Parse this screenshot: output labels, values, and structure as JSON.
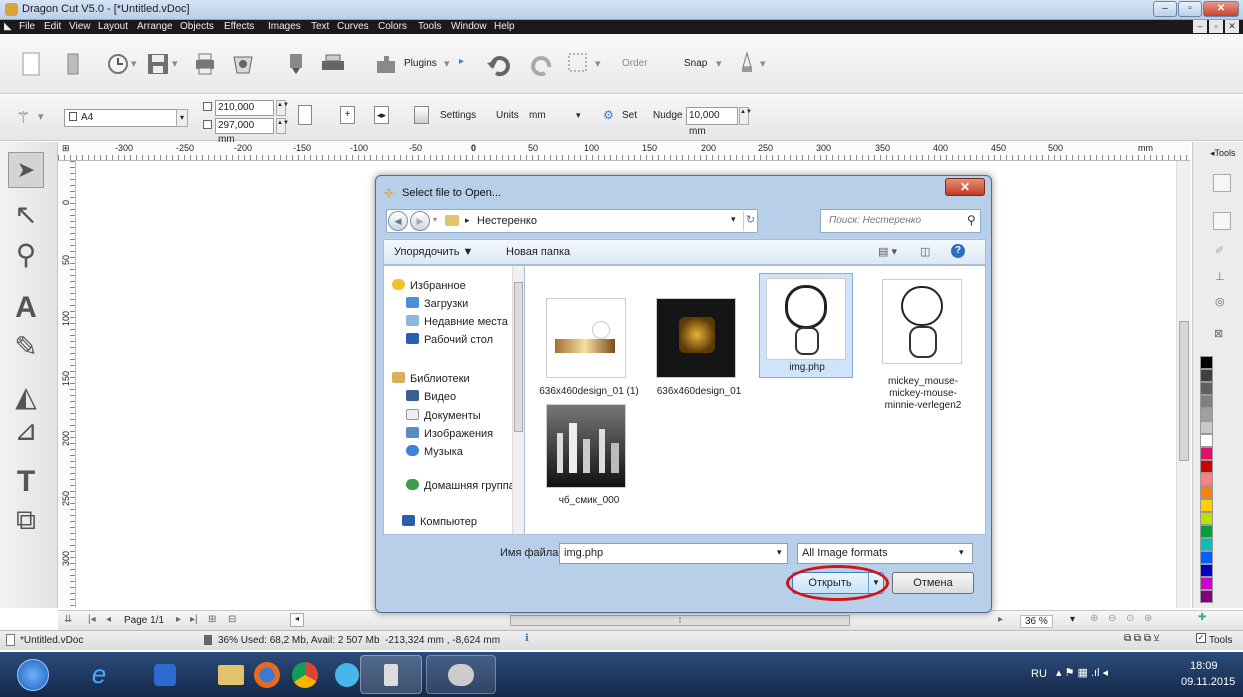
{
  "window": {
    "title": "Dragon Cut V5.0 - [*Untitled.vDoc]"
  },
  "menu": [
    "File",
    "Edit",
    "View",
    "Layout",
    "Arrange",
    "Objects",
    "Effects",
    "Images",
    "Text",
    "Curves",
    "Colors",
    "Tools",
    "Window",
    "Help"
  ],
  "toolbar": {
    "plugins": "Plugins",
    "order": "Order",
    "snap": "Snap"
  },
  "props": {
    "page_size": "A4",
    "width": "210,000 mm",
    "height": "297,000 mm",
    "settings": "Settings",
    "units_label": "Units",
    "units_value": "mm",
    "set": "Set",
    "nudge_label": "Nudge",
    "nudge_value": "10,000 mm"
  },
  "ruler": {
    "top": [
      "-300",
      "-250",
      "-200",
      "-150",
      "-100",
      "-50",
      "0",
      "50",
      "100",
      "150",
      "200",
      "250",
      "300",
      "350",
      "400",
      "450",
      "500"
    ],
    "unit": "mm",
    "left": [
      "0",
      "50",
      "100",
      "150",
      "200",
      "250",
      "300"
    ]
  },
  "right_panel": {
    "title": "Tools"
  },
  "palette": [
    "#000000",
    "#404040",
    "#606060",
    "#808080",
    "#a0a0a0",
    "#c8c8c8",
    "#ffffff",
    "#e0106a",
    "#d00000",
    "#ff8080",
    "#ff8000",
    "#ffd000",
    "#c0e000",
    "#00a040",
    "#00c0c0",
    "#0060ff",
    "#0000c0",
    "#d000d0",
    "#800080"
  ],
  "bottom": {
    "page": "Page 1/1",
    "zoom": "36 %"
  },
  "status": {
    "doc": "*Untitled.vDoc",
    "memory": "36%  Used: 68,2 Mb, Avail: 2 507 Mb",
    "coords": "-213,324 mm , -8,624 mm",
    "tools": "Tools"
  },
  "taskbar": {
    "lang": "RU",
    "time": "18:09",
    "date": "09.11.2015"
  },
  "dialog": {
    "title": "Select file to Open...",
    "path": "Нестеренко",
    "search_placeholder": "Поиск: Нестеренко",
    "organize": "Упорядочить ▼",
    "new_folder": "Новая папка",
    "nav": [
      "Избранное",
      "Загрузки",
      "Недавние места",
      "Рабочий стол",
      "Библиотеки",
      "Видео",
      "Документы",
      "Изображения",
      "Музыка",
      "Домашняя группа",
      "Компьютер"
    ],
    "files": [
      "636x460design_01 (1)",
      "636x460design_01",
      "img.php",
      "mickey_mouse-mickey-mouse-minnie-verlegen2",
      "чб_смик_000"
    ],
    "filename_label": "Имя файла:",
    "filename_value": "img.php",
    "filter": "All Image formats",
    "open": "Открыть",
    "cancel": "Отмена"
  }
}
